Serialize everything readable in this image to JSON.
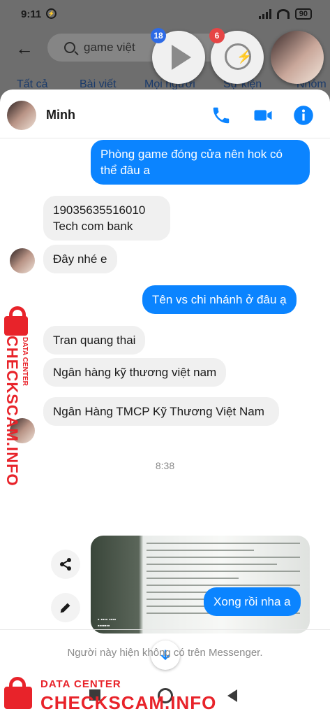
{
  "status_bar": {
    "time": "9:11",
    "battery": "90"
  },
  "background_app": {
    "search_text": "game việt",
    "tabs": [
      "Tất cả",
      "Bài viết",
      "Mọi người",
      "Sự kiện",
      "Nhóm"
    ]
  },
  "chat_heads": {
    "play_badge": "18",
    "messenger_badge": "6"
  },
  "chat": {
    "contact_name": "Minh",
    "messages": [
      {
        "text": "Phòng game đóng cửa nên hok có thể đâu a"
      },
      {
        "text": "19035635516010\nTech com bank"
      },
      {
        "text": "Đây nhé e"
      },
      {
        "text": "Tên vs chi nhánh ở đâu ạ"
      },
      {
        "text": "Tran quang thai"
      },
      {
        "text": "Ngân hàng kỹ thương việt nam"
      },
      {
        "text": "Ngân Hàng TMCP Kỹ Thương Việt Nam"
      },
      {
        "text": "Xong rồi nha a"
      }
    ],
    "timestamp": "8:38",
    "composer_note": "Người này hiện không có trên Messenger."
  },
  "watermark": {
    "small": "DATA CENTER",
    "big": "CHECKSCAM.INFO"
  },
  "icons": {
    "back": "arrow-left-icon",
    "search": "search-icon",
    "phone": "phone-icon",
    "video": "video-camera-icon",
    "info": "info-icon",
    "share": "share-icon",
    "edit": "pencil-icon",
    "scroll": "arrow-down-icon"
  },
  "colors": {
    "outgoing": "#0b84ff",
    "incoming": "#f0f0f0",
    "watermark": "#e8232a"
  }
}
